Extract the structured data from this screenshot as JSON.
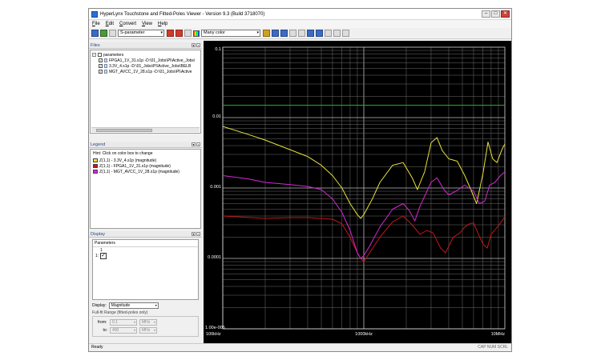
{
  "window": {
    "title": "HyperLynx Touchstone and Fitted-Poles Viewer - Version 9.3 (Build 3718070)",
    "controls": {
      "minimize": "–",
      "maximize": "□",
      "close": "✕"
    }
  },
  "menu": [
    "File",
    "Edit",
    "Convert",
    "View",
    "Help"
  ],
  "toolbar": {
    "param_select": "S-parameter",
    "color_select": "Many color"
  },
  "files_panel": {
    "title": "Files",
    "root": "parameters",
    "items": [
      "FPGA1_1V_31.s1p -D:\\01_Jobs\\PI\\Active_Jobs\\",
      "3.3V_4.s1p -D:\\01_Jobs\\PI\\Active_Jobs\\BELB",
      "MGT_AVCC_1V_28.s1p -D:\\01_Jobs\\PI\\Active"
    ]
  },
  "legend_panel": {
    "title": "Legend",
    "hint": "Hint:  Click on color box to change",
    "entries": [
      {
        "label": "Z(1,1) - 3.3V_4.s1p (magnitude)",
        "color": "#e8e23a"
      },
      {
        "label": "Z(1,1) - FPGA1_1V_31.s1p (magnitude)",
        "color": "#c41818"
      },
      {
        "label": "Z(1,1) - MGT_AVCC_1V_28.s1p (magnitude)",
        "color": "#d429d4"
      }
    ]
  },
  "display_panel": {
    "title": "Display",
    "params_label": "Parameters",
    "col_label": "1",
    "row_label": "1:",
    "display_label": "Display:",
    "display_value": "Magnitude",
    "range_title": "Full-fit Range (fitted-poles only)",
    "from_label": "from:",
    "from_value": "0.1",
    "from_unit": "MHz",
    "to_label": "to:",
    "to_value": "400",
    "to_unit": "MHz"
  },
  "status": {
    "left": "Ready",
    "right": "CAP NUM SCRL"
  },
  "chart_data": {
    "type": "line",
    "xscale": "log",
    "yscale": "log",
    "xlim": [
      100000,
      10000000
    ],
    "ylim": [
      1e-05,
      0.1
    ],
    "x_ticks": [
      "100kHz",
      "1000kHz",
      "10MHz"
    ],
    "y_ticks": [
      "0.1",
      "0.01",
      "0.001",
      "0.0001",
      "1.00e-005"
    ],
    "grid": true,
    "series": [
      {
        "name": "Z(1,1) - 3.3V_4.s1p (magnitude)",
        "color": "#e8e23a",
        "points": [
          [
            100000,
            0.0075
          ],
          [
            150000,
            0.0058
          ],
          [
            200000,
            0.0048
          ],
          [
            300000,
            0.0035
          ],
          [
            400000,
            0.0028
          ],
          [
            500000,
            0.0021
          ],
          [
            600000,
            0.0015
          ],
          [
            700000,
            0.001
          ],
          [
            800000,
            0.0006
          ],
          [
            900000,
            0.00042
          ],
          [
            950000,
            0.00037
          ],
          [
            1000000,
            0.00042
          ],
          [
            1150000,
            0.0007
          ],
          [
            1300000,
            0.0012
          ],
          [
            1600000,
            0.0021
          ],
          [
            1900000,
            0.0023
          ],
          [
            2200000,
            0.0014
          ],
          [
            2400000,
            0.00095
          ],
          [
            2700000,
            0.0017
          ],
          [
            3000000,
            0.0044
          ],
          [
            3300000,
            0.0052
          ],
          [
            3600000,
            0.0034
          ],
          [
            4000000,
            0.0026
          ],
          [
            4600000,
            0.0024
          ],
          [
            5200000,
            0.0015
          ],
          [
            5800000,
            0.0009
          ],
          [
            6300000,
            0.0006
          ],
          [
            7000000,
            0.0016
          ],
          [
            7600000,
            0.0045
          ],
          [
            8200000,
            0.0026
          ],
          [
            8800000,
            0.0023
          ],
          [
            9300000,
            0.0031
          ],
          [
            9700000,
            0.0038
          ],
          [
            10000000,
            0.0042
          ]
        ]
      },
      {
        "name": "Z(1,1) - FPGA1_1V_31.s1p (magnitude)",
        "color": "#c41818",
        "points": [
          [
            100000,
            0.0004
          ],
          [
            200000,
            0.00037
          ],
          [
            300000,
            0.00038
          ],
          [
            400000,
            0.00038
          ],
          [
            600000,
            0.00036
          ],
          [
            700000,
            0.00031
          ],
          [
            800000,
            0.0002
          ],
          [
            900000,
            0.00012
          ],
          [
            950000,
            0.0001
          ],
          [
            1000000,
            9e-05
          ],
          [
            1100000,
            0.00012
          ],
          [
            1300000,
            0.0002
          ],
          [
            1600000,
            0.00033
          ],
          [
            1900000,
            0.0004
          ],
          [
            2200000,
            0.0003
          ],
          [
            2500000,
            0.00022
          ],
          [
            2800000,
            0.00025
          ],
          [
            3100000,
            0.00023
          ],
          [
            3500000,
            0.00014
          ],
          [
            3800000,
            0.00012
          ],
          [
            4300000,
            0.0002
          ],
          [
            4800000,
            0.00023
          ],
          [
            5200000,
            0.00028
          ],
          [
            5600000,
            0.00031
          ],
          [
            6000000,
            0.00032
          ],
          [
            6500000,
            0.00022
          ],
          [
            7000000,
            0.00016
          ],
          [
            7500000,
            0.00014
          ],
          [
            8000000,
            0.00022
          ],
          [
            9000000,
            0.00029
          ],
          [
            10000000,
            0.00039
          ]
        ]
      },
      {
        "name": "Z(1,1) - MGT_AVCC_1V_28.s1p (magnitude)",
        "color": "#d429d4",
        "points": [
          [
            100000,
            0.0015
          ],
          [
            150000,
            0.00135
          ],
          [
            200000,
            0.0012
          ],
          [
            300000,
            0.00112
          ],
          [
            400000,
            0.00105
          ],
          [
            500000,
            0.00095
          ],
          [
            600000,
            0.0007
          ],
          [
            700000,
            0.00045
          ],
          [
            800000,
            0.00025
          ],
          [
            900000,
            0.00012
          ],
          [
            950000,
            0.0001
          ],
          [
            1000000,
            0.00011
          ],
          [
            1100000,
            0.00015
          ],
          [
            1300000,
            0.00028
          ],
          [
            1600000,
            0.0005
          ],
          [
            1900000,
            0.0006
          ],
          [
            2100000,
            0.00048
          ],
          [
            2300000,
            0.00034
          ],
          [
            2500000,
            0.00055
          ],
          [
            3000000,
            0.0012
          ],
          [
            3300000,
            0.0014
          ],
          [
            3700000,
            0.00095
          ],
          [
            4000000,
            0.0008
          ],
          [
            4500000,
            0.0009
          ],
          [
            5200000,
            0.0011
          ],
          [
            6000000,
            0.0009
          ],
          [
            6600000,
            0.0006
          ],
          [
            7200000,
            0.00065
          ],
          [
            7800000,
            0.0011
          ],
          [
            8500000,
            0.0012
          ],
          [
            9300000,
            0.0015
          ],
          [
            10000000,
            0.0017
          ]
        ]
      },
      {
        "name": "",
        "color": "#1fae1f",
        "points": [
          [
            100000,
            0.015
          ],
          [
            10000000,
            0.015
          ]
        ]
      }
    ]
  }
}
